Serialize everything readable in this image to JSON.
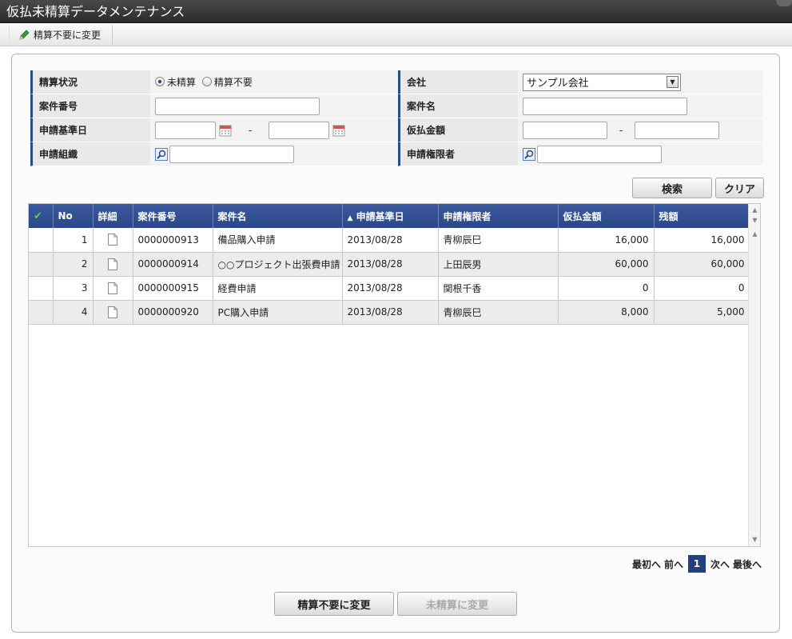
{
  "window": {
    "title": "仮払未精算データメンテナンス"
  },
  "toolbar": {
    "change_not_required_label": "精算不要に変更"
  },
  "search": {
    "settlement_status": {
      "label": "精算状況",
      "options": [
        "未精算",
        "精算不要"
      ],
      "selected": "未精算"
    },
    "company": {
      "label": "会社",
      "value": "サンプル会社"
    },
    "case_number": {
      "label": "案件番号",
      "value": ""
    },
    "case_name": {
      "label": "案件名",
      "value": ""
    },
    "base_date": {
      "label": "申請基準日",
      "from": "",
      "to": "",
      "separator": "-"
    },
    "advance_amount": {
      "label": "仮払金額",
      "from": "",
      "to": "",
      "separator": "-"
    },
    "organization": {
      "label": "申請組織",
      "value": ""
    },
    "authority": {
      "label": "申請権限者",
      "value": ""
    },
    "search_button": "検索",
    "clear_button": "クリア"
  },
  "grid": {
    "columns": {
      "check": "✔",
      "no": "No",
      "detail": "詳細",
      "case_number": "案件番号",
      "case_name": "案件名",
      "base_date": "申請基準日",
      "authority": "申請権限者",
      "amount": "仮払金額",
      "balance": "残額"
    },
    "sort_indicator": "▲",
    "rows": [
      {
        "no": "1",
        "case_number": "0000000913",
        "case_name": "備品購入申請",
        "base_date": "2013/08/28",
        "authority": "青柳辰巳",
        "amount": "16,000",
        "balance": "16,000"
      },
      {
        "no": "2",
        "case_number": "0000000914",
        "case_name": "○○プロジェクト出張費申請",
        "base_date": "2013/08/28",
        "authority": "上田辰男",
        "amount": "60,000",
        "balance": "60,000"
      },
      {
        "no": "3",
        "case_number": "0000000915",
        "case_name": "経費申請",
        "base_date": "2013/08/28",
        "authority": "関根千香",
        "amount": "0",
        "balance": "0"
      },
      {
        "no": "4",
        "case_number": "0000000920",
        "case_name": "PC購入申請",
        "base_date": "2013/08/28",
        "authority": "青柳辰巳",
        "amount": "8,000",
        "balance": "5,000"
      }
    ]
  },
  "pager": {
    "first": "最初へ",
    "prev": "前へ",
    "current": "1",
    "next": "次へ",
    "last": "最後へ"
  },
  "footer": {
    "change_not_required_button": "精算不要に変更",
    "change_unsettled_button": "未精算に変更"
  },
  "colors": {
    "header_blue": "#2b4788",
    "label_accent": "#2c4a8a",
    "current_page": "#243f7f"
  }
}
